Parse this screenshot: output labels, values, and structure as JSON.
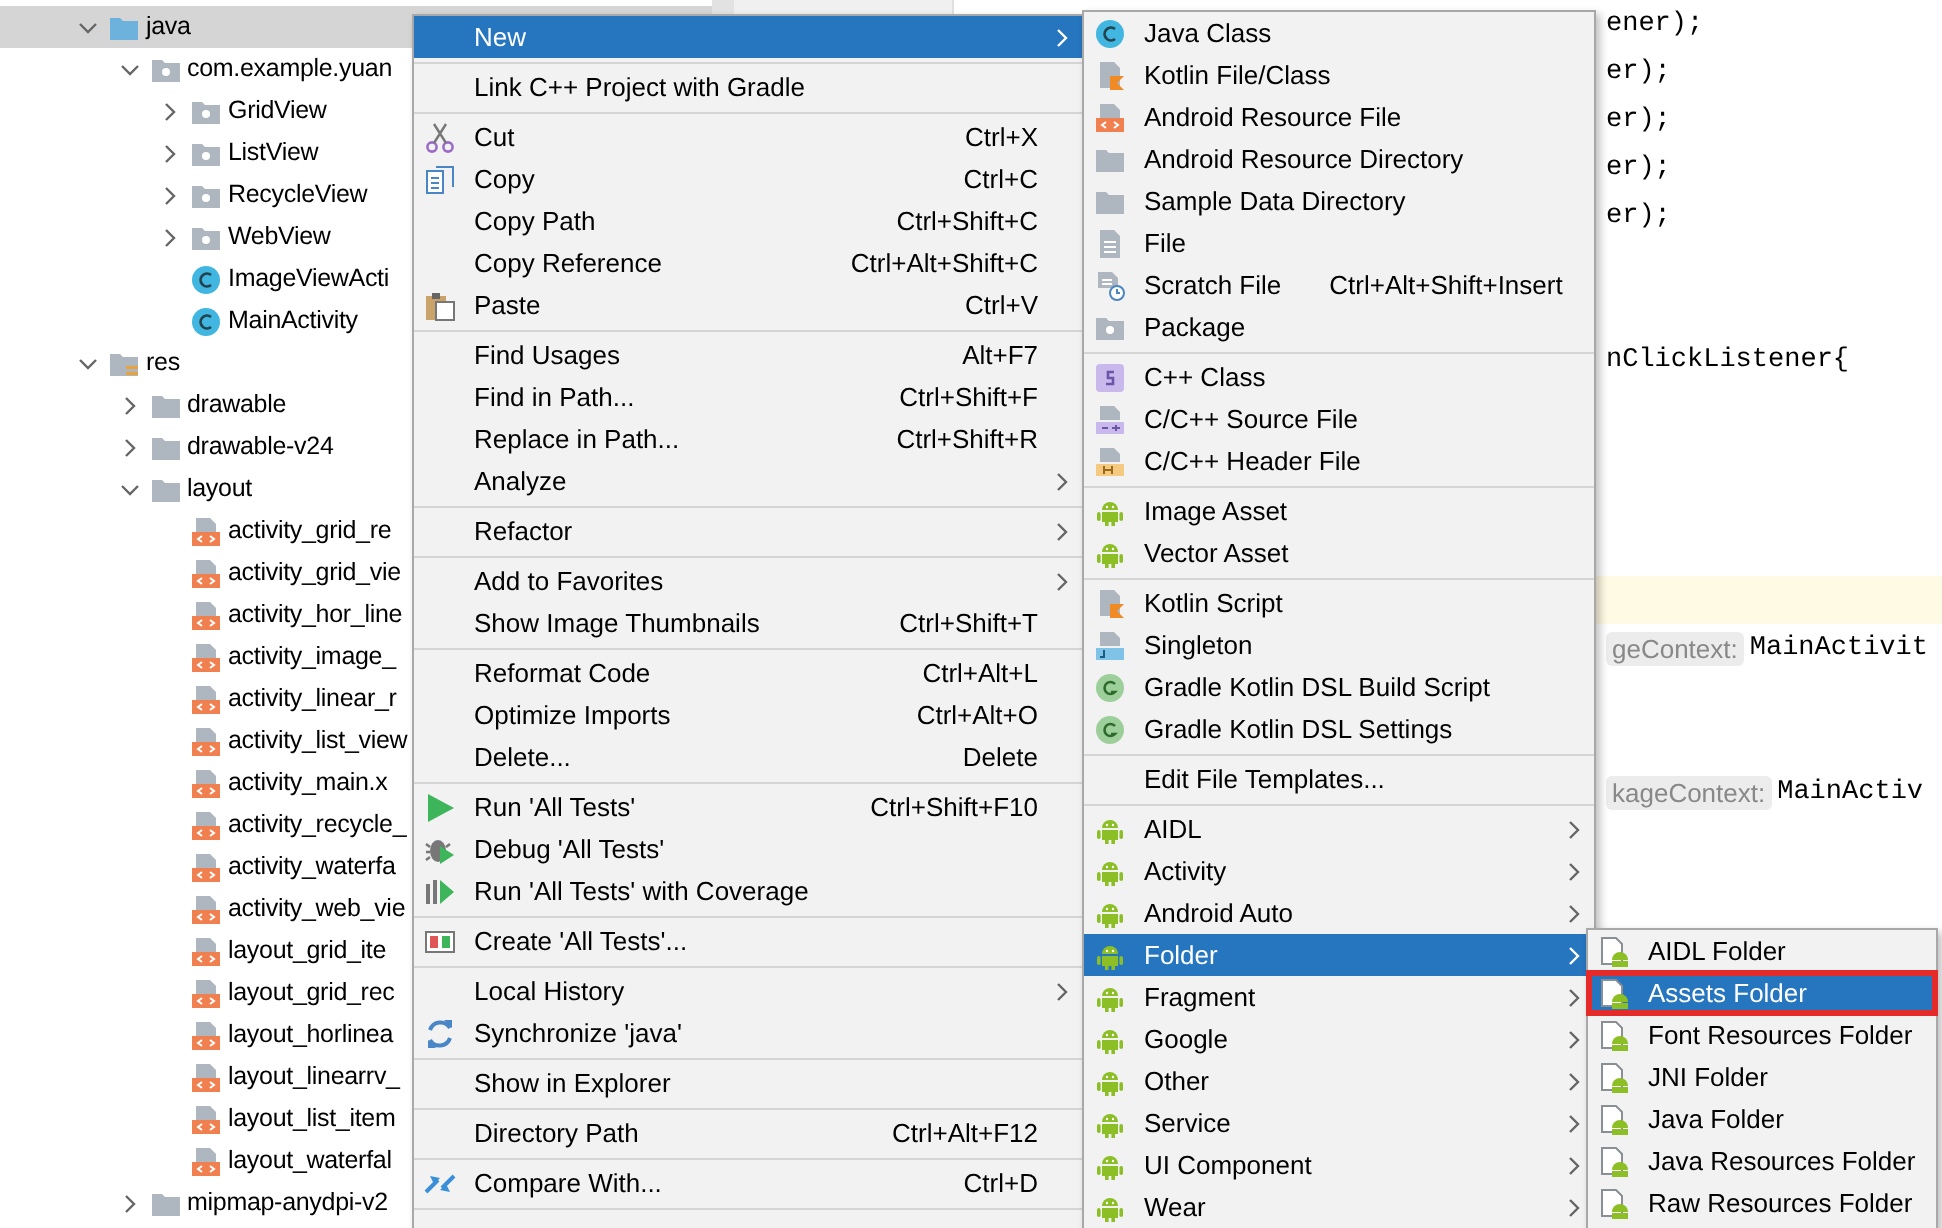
{
  "project_tree": {
    "nodes": [
      {
        "label": "java",
        "kind": "source-folder",
        "expanded": true,
        "selected": true,
        "children": [
          {
            "label": "com.example.yuan",
            "kind": "package",
            "expanded": true,
            "selected": false,
            "children": [
              {
                "label": "GridView",
                "kind": "package",
                "expanded": false,
                "selected": false
              },
              {
                "label": "ListView",
                "kind": "package",
                "expanded": false,
                "selected": false
              },
              {
                "label": "RecycleView",
                "kind": "package",
                "expanded": false,
                "selected": false
              },
              {
                "label": "WebView",
                "kind": "package",
                "expanded": false,
                "selected": false
              },
              {
                "label": "ImageViewActi",
                "kind": "class",
                "selected": false
              },
              {
                "label": "MainActivity",
                "kind": "class",
                "selected": false
              }
            ]
          }
        ]
      },
      {
        "label": "res",
        "kind": "res-folder",
        "expanded": true,
        "selected": false,
        "children": [
          {
            "label": "drawable",
            "kind": "folder",
            "expanded": false,
            "selected": false
          },
          {
            "label": "drawable-v24",
            "kind": "folder",
            "expanded": false,
            "selected": false
          },
          {
            "label": "layout",
            "kind": "folder",
            "expanded": true,
            "selected": false,
            "children": [
              {
                "label": "activity_grid_re",
                "kind": "layout-file",
                "selected": false
              },
              {
                "label": "activity_grid_vie",
                "kind": "layout-file",
                "selected": false
              },
              {
                "label": "activity_hor_line",
                "kind": "layout-file",
                "selected": false
              },
              {
                "label": "activity_image_",
                "kind": "layout-file",
                "selected": false
              },
              {
                "label": "activity_linear_r",
                "kind": "layout-file",
                "selected": false
              },
              {
                "label": "activity_list_view",
                "kind": "layout-file",
                "selected": false
              },
              {
                "label": "activity_main.x",
                "kind": "layout-file",
                "selected": false
              },
              {
                "label": "activity_recycle_",
                "kind": "layout-file",
                "selected": false
              },
              {
                "label": "activity_waterfa",
                "kind": "layout-file",
                "selected": false
              },
              {
                "label": "activity_web_vie",
                "kind": "layout-file",
                "selected": false
              },
              {
                "label": "layout_grid_ite",
                "kind": "layout-file",
                "selected": false
              },
              {
                "label": "layout_grid_rec",
                "kind": "layout-file",
                "selected": false
              },
              {
                "label": "layout_horlinea",
                "kind": "layout-file",
                "selected": false
              },
              {
                "label": "layout_linearrv_",
                "kind": "layout-file",
                "selected": false
              },
              {
                "label": "layout_list_item",
                "kind": "layout-file",
                "selected": false
              },
              {
                "label": "layout_waterfal",
                "kind": "layout-file",
                "selected": false
              }
            ]
          },
          {
            "label": "mipmap-anydpi-v2",
            "kind": "folder",
            "expanded": false,
            "selected": false
          }
        ]
      }
    ]
  },
  "editor": {
    "lines": [
      {
        "kind": "clipped",
        "text": "ener);",
        "current": false
      },
      {
        "kind": "clipped",
        "text": "er);",
        "current": false
      },
      {
        "kind": "clipped",
        "text": "er);",
        "current": false
      },
      {
        "kind": "clipped",
        "text": "er);",
        "current": false
      },
      {
        "kind": "clipped",
        "text": "er);",
        "current": false
      },
      {
        "kind": "blank",
        "current": false
      },
      {
        "kind": "blank",
        "current": false
      },
      {
        "kind": "clipped",
        "text": "nClickListener{",
        "current": false
      },
      {
        "kind": "blank",
        "current": false
      },
      {
        "kind": "blank",
        "current": false
      },
      {
        "kind": "blank",
        "current": false
      },
      {
        "kind": "blank",
        "current": false
      },
      {
        "kind": "blank",
        "current": true
      },
      {
        "kind": "clipped",
        "hint": "geContext:",
        "text": "MainActivit",
        "current": false
      },
      {
        "kind": "blank",
        "current": false
      },
      {
        "kind": "blank",
        "current": false
      },
      {
        "kind": "clipped",
        "hint": "kageContext:",
        "text": "MainActiv",
        "current": false
      }
    ]
  },
  "context_menu": {
    "groups": [
      [
        {
          "label": "New",
          "arrow": true,
          "selected": true
        }
      ],
      [
        {
          "label": "Link C++ Project with Gradle",
          "arrow": false,
          "selected": false
        }
      ],
      [
        {
          "label": "Cut",
          "kind": "scissors",
          "shortcut": "Ctrl+X",
          "arrow": false,
          "selected": false
        },
        {
          "label": "Copy",
          "kind": "copy",
          "shortcut": "Ctrl+C",
          "arrow": false,
          "selected": false
        },
        {
          "label": "Copy Path",
          "shortcut": "Ctrl+Shift+C",
          "arrow": false,
          "selected": false
        },
        {
          "label": "Copy Reference",
          "shortcut": "Ctrl+Alt+Shift+C",
          "arrow": false,
          "selected": false
        },
        {
          "label": "Paste",
          "kind": "paste",
          "shortcut": "Ctrl+V",
          "arrow": false,
          "selected": false
        }
      ],
      [
        {
          "label": "Find Usages",
          "shortcut": "Alt+F7",
          "arrow": false,
          "selected": false
        },
        {
          "label": "Find in Path...",
          "shortcut": "Ctrl+Shift+F",
          "arrow": false,
          "selected": false
        },
        {
          "label": "Replace in Path...",
          "shortcut": "Ctrl+Shift+R",
          "arrow": false,
          "selected": false
        },
        {
          "label": "Analyze",
          "arrow": true,
          "selected": false
        }
      ],
      [
        {
          "label": "Refactor",
          "arrow": true,
          "selected": false
        }
      ],
      [
        {
          "label": "Add to Favorites",
          "arrow": true,
          "selected": false
        },
        {
          "label": "Show Image Thumbnails",
          "shortcut": "Ctrl+Shift+T",
          "arrow": false,
          "selected": false
        }
      ],
      [
        {
          "label": "Reformat Code",
          "shortcut": "Ctrl+Alt+L",
          "arrow": false,
          "selected": false
        },
        {
          "label": "Optimize Imports",
          "shortcut": "Ctrl+Alt+O",
          "arrow": false,
          "selected": false
        },
        {
          "label": "Delete...",
          "shortcut": "Delete",
          "arrow": false,
          "selected": false
        }
      ],
      [
        {
          "label": "Run 'All Tests'",
          "kind": "run",
          "shortcut": "Ctrl+Shift+F10",
          "arrow": false,
          "selected": false
        },
        {
          "label": "Debug 'All Tests'",
          "kind": "debug",
          "arrow": false,
          "selected": false
        },
        {
          "label": "Run 'All Tests' with Coverage",
          "kind": "coverage",
          "arrow": false,
          "selected": false
        }
      ],
      [
        {
          "label": "Create 'All Tests'...",
          "kind": "test-create",
          "arrow": false,
          "selected": false
        }
      ],
      [
        {
          "label": "Local History",
          "arrow": true,
          "selected": false
        },
        {
          "label": "Synchronize 'java'",
          "kind": "sync",
          "arrow": false,
          "selected": false
        }
      ],
      [
        {
          "label": "Show in Explorer",
          "arrow": false,
          "selected": false
        }
      ],
      [
        {
          "label": "Directory Path",
          "shortcut": "Ctrl+Alt+F12",
          "arrow": false,
          "selected": false
        }
      ],
      [
        {
          "label": "Compare With...",
          "kind": "compare",
          "shortcut": "Ctrl+D",
          "arrow": false,
          "selected": false
        }
      ]
    ]
  },
  "new_submenu": {
    "groups": [
      [
        {
          "label": "Java Class",
          "kind": "class",
          "arrow": false,
          "selected": false
        },
        {
          "label": "Kotlin File/Class",
          "kind": "kotlin-file",
          "arrow": false,
          "selected": false
        },
        {
          "label": "Android Resource File",
          "kind": "layout-file",
          "arrow": false,
          "selected": false
        },
        {
          "label": "Android Resource Directory",
          "kind": "folder",
          "arrow": false,
          "selected": false
        },
        {
          "label": "Sample Data Directory",
          "kind": "folder",
          "arrow": false,
          "selected": false
        },
        {
          "label": "File",
          "kind": "file",
          "arrow": false,
          "selected": false
        },
        {
          "label": "Scratch File",
          "kind": "scratch",
          "shortcut": "Ctrl+Alt+Shift+Insert",
          "arrow": false,
          "selected": false
        },
        {
          "label": "Package",
          "kind": "package",
          "arrow": false,
          "selected": false
        }
      ],
      [
        {
          "label": "C++ Class",
          "kind": "cpp-class",
          "arrow": false,
          "selected": false
        },
        {
          "label": "C/C++ Source File",
          "kind": "cpp-source",
          "arrow": false,
          "selected": false
        },
        {
          "label": "C/C++ Header File",
          "kind": "cpp-header",
          "arrow": false,
          "selected": false
        }
      ],
      [
        {
          "label": "Image Asset",
          "kind": "android",
          "arrow": false,
          "selected": false
        },
        {
          "label": "Vector Asset",
          "kind": "android",
          "arrow": false,
          "selected": false
        }
      ],
      [
        {
          "label": "Kotlin Script",
          "kind": "kotlin-file",
          "arrow": false,
          "selected": false
        },
        {
          "label": "Singleton",
          "kind": "singleton",
          "arrow": false,
          "selected": false
        },
        {
          "label": "Gradle Kotlin DSL Build Script",
          "kind": "gradle",
          "arrow": false,
          "selected": false
        },
        {
          "label": "Gradle Kotlin DSL Settings",
          "kind": "gradle",
          "arrow": false,
          "selected": false
        }
      ],
      [
        {
          "label": "Edit File Templates...",
          "arrow": false,
          "selected": false
        }
      ],
      [
        {
          "label": "AIDL",
          "kind": "android",
          "arrow": true,
          "selected": false
        },
        {
          "label": "Activity",
          "kind": "android",
          "arrow": true,
          "selected": false
        },
        {
          "label": "Android Auto",
          "kind": "android",
          "arrow": true,
          "selected": false
        },
        {
          "label": "Folder",
          "kind": "android",
          "arrow": true,
          "selected": true
        },
        {
          "label": "Fragment",
          "kind": "android",
          "arrow": true,
          "selected": false
        },
        {
          "label": "Google",
          "kind": "android",
          "arrow": true,
          "selected": false
        },
        {
          "label": "Other",
          "kind": "android",
          "arrow": true,
          "selected": false
        },
        {
          "label": "Service",
          "kind": "android",
          "arrow": true,
          "selected": false
        },
        {
          "label": "UI Component",
          "kind": "android",
          "arrow": true,
          "selected": false
        },
        {
          "label": "Wear",
          "kind": "android",
          "arrow": true,
          "selected": false
        }
      ]
    ]
  },
  "folder_submenu": {
    "groups": [
      [
        {
          "label": "AIDL Folder",
          "kind": "android-file",
          "arrow": false,
          "selected": false,
          "annotated": false
        },
        {
          "label": "Assets Folder",
          "kind": "android-file",
          "arrow": false,
          "selected": true,
          "annotated": true
        },
        {
          "label": "Font Resources Folder",
          "kind": "android-file",
          "arrow": false,
          "selected": false,
          "annotated": false
        },
        {
          "label": "JNI Folder",
          "kind": "android-file",
          "arrow": false,
          "selected": false,
          "annotated": false
        },
        {
          "label": "Java Folder",
          "kind": "android-file",
          "arrow": false,
          "selected": false,
          "annotated": false
        },
        {
          "label": "Java Resources Folder",
          "kind": "android-file",
          "arrow": false,
          "selected": false,
          "annotated": false
        },
        {
          "label": "Raw Resources Folder",
          "kind": "android-file",
          "arrow": false,
          "selected": false,
          "annotated": false
        }
      ]
    ]
  }
}
